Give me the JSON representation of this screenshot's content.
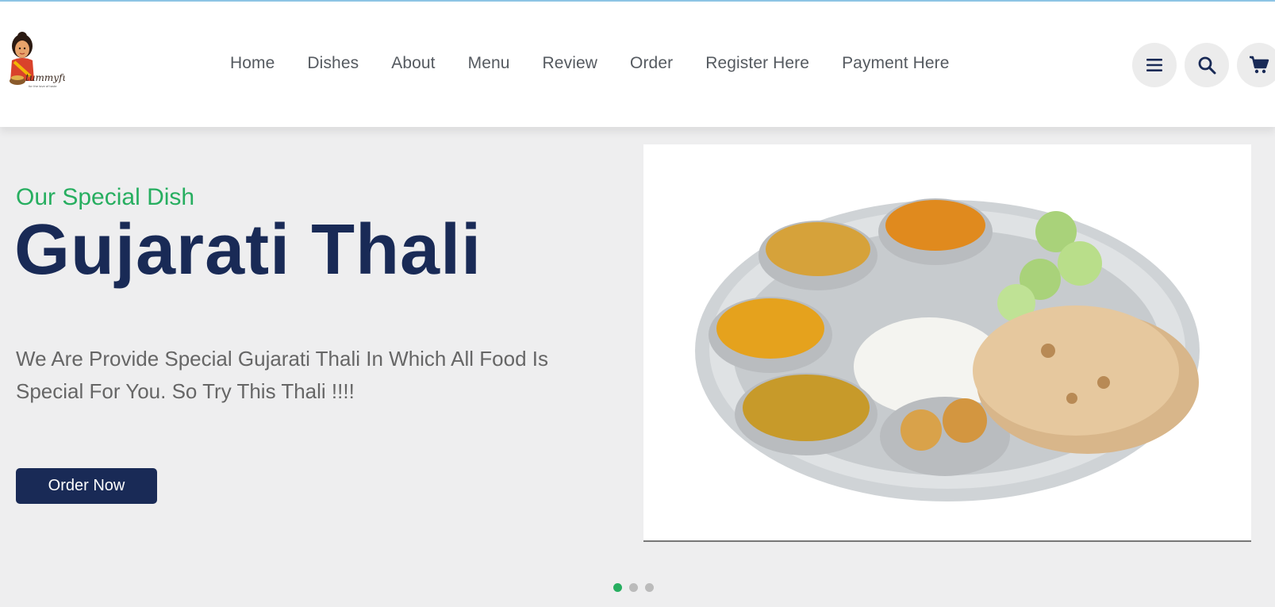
{
  "brand": {
    "logo_text": "tummyfull",
    "logo_tagline": "for the love of taste"
  },
  "nav": {
    "items": [
      {
        "label": "Home"
      },
      {
        "label": "Dishes"
      },
      {
        "label": "About"
      },
      {
        "label": "Menu"
      },
      {
        "label": "Review"
      },
      {
        "label": "Order"
      },
      {
        "label": "Register Here"
      },
      {
        "label": "Payment Here"
      }
    ]
  },
  "header_icons": [
    "menu-bars-icon",
    "search-icon",
    "shopping-cart-icon"
  ],
  "hero": {
    "subtitle": "Our Special Dish",
    "title": "Gujarati Thali",
    "description": "We Are Provide Special Gujarati Thali In Which All Food Is Special For You. So Try This Thali !!!!",
    "button_label": "Order Now",
    "slides": {
      "count": 3,
      "active_index": 0
    }
  },
  "colors": {
    "accent_green": "#27ae60",
    "navy": "#192a56",
    "text_gray": "#666666",
    "background": "#eeeeef"
  }
}
